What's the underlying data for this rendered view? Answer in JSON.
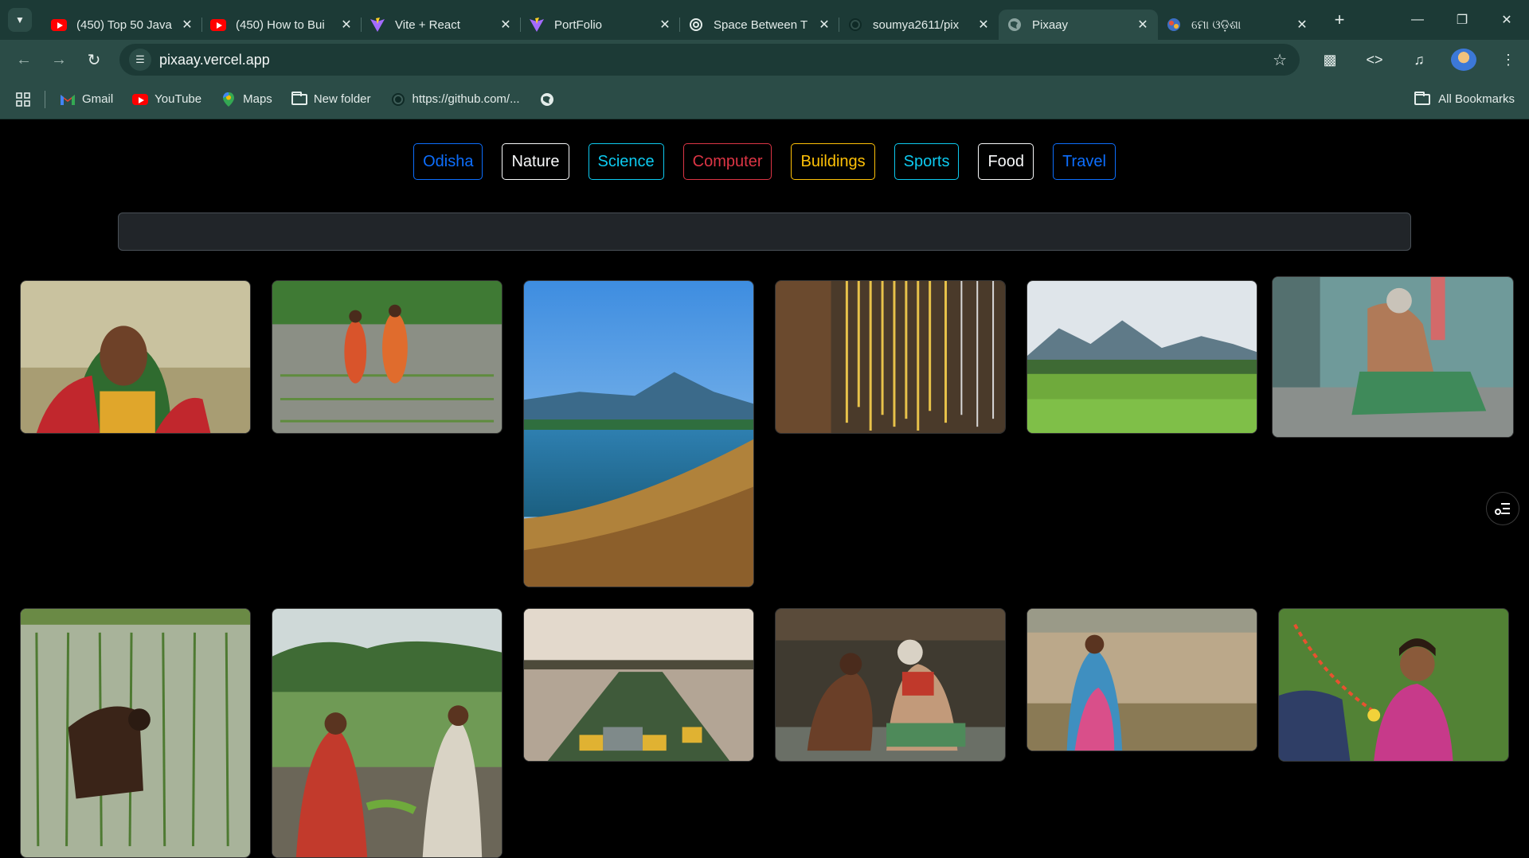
{
  "browser": {
    "tabs": [
      {
        "title": "(450) Top 50 Java",
        "favicon": "youtube-icon"
      },
      {
        "title": "(450) How to Bui",
        "favicon": "youtube-icon"
      },
      {
        "title": "Vite + React",
        "favicon": "vite-icon"
      },
      {
        "title": "PortFolio",
        "favicon": "vite-icon"
      },
      {
        "title": "Space Between T",
        "favicon": "openai-icon"
      },
      {
        "title": "soumya2611/pix",
        "favicon": "github-icon"
      },
      {
        "title": "Pixaay",
        "favicon": "globe-icon",
        "active": true
      },
      {
        "title": "ମୋ ଓଡ଼ିଶା",
        "favicon": "odisha-icon"
      }
    ],
    "url": "pixaay.vercel.app",
    "bookmarks": [
      {
        "label": "Gmail",
        "icon": "gmail-icon"
      },
      {
        "label": "YouTube",
        "icon": "youtube-icon"
      },
      {
        "label": "Maps",
        "icon": "maps-icon"
      },
      {
        "label": "New folder",
        "icon": "folder-icon"
      },
      {
        "label": "https://github.com/...",
        "icon": "github-icon"
      }
    ],
    "all_bookmarks": "All Bookmarks"
  },
  "categories": [
    {
      "label": "Odisha",
      "color": "#0d6efd"
    },
    {
      "label": "Nature",
      "color": "#f8f9fa"
    },
    {
      "label": "Science",
      "color": "#0dcaf0"
    },
    {
      "label": "Computer",
      "color": "#dc3545"
    },
    {
      "label": "Buildings",
      "color": "#ffc107"
    },
    {
      "label": "Sports",
      "color": "#0dcaf0"
    },
    {
      "label": "Food",
      "color": "#f8f9fa"
    },
    {
      "label": "Travel",
      "color": "#0d6efd"
    }
  ],
  "search": {
    "value": "",
    "placeholder": ""
  },
  "gallery": {
    "photos": [
      {
        "name": "woman-in-saree-smiling"
      },
      {
        "name": "women-planting-rice"
      },
      {
        "name": "lake-and-hills"
      },
      {
        "name": "gold-jewellery"
      },
      {
        "name": "green-fields-mountains"
      },
      {
        "name": "old-man-craftsman"
      },
      {
        "name": "man-in-rice-paddy"
      },
      {
        "name": "women-with-rice-seedlings"
      },
      {
        "name": "wooden-boat-river"
      },
      {
        "name": "barber-shaving-man"
      },
      {
        "name": "woman-in-field"
      },
      {
        "name": "girl-playing-holi"
      }
    ]
  }
}
